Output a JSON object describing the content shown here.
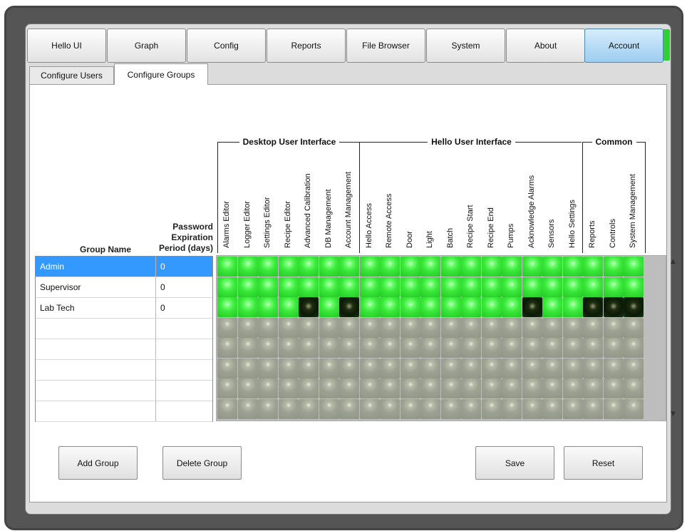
{
  "top_tabs": [
    {
      "label": "Hello UI",
      "active": false
    },
    {
      "label": "Graph",
      "active": false
    },
    {
      "label": "Config",
      "active": false
    },
    {
      "label": "Reports",
      "active": false
    },
    {
      "label": "File Browser",
      "active": false
    },
    {
      "label": "System",
      "active": false
    },
    {
      "label": "About",
      "active": false
    },
    {
      "label": "Account",
      "active": true
    }
  ],
  "sub_tabs": [
    {
      "label": "Configure Users",
      "active": false
    },
    {
      "label": "Configure Groups",
      "active": true
    }
  ],
  "column_groups": [
    {
      "label": "Desktop User Interface"
    },
    {
      "label": "Hello User Interface"
    },
    {
      "label": "Common"
    }
  ],
  "permissions": [
    "Alarms Editor",
    "Logger Editor",
    "Settings Editor",
    "Recipe Editor",
    "Advanced Calibration",
    "DB Management",
    "Account Management",
    "Hello Access",
    "Remote Access",
    "Door",
    "Light",
    "Batch",
    "Recipe Start",
    "Recipe End",
    "Pumps",
    "Acknowledge Alarms",
    "Sensors",
    "Hello Settings",
    "Reports",
    "Controls",
    "System Management"
  ],
  "table_headers": {
    "group_name": "Group Name",
    "password_expiration": [
      "Password",
      "Expiration",
      "Period (days)"
    ]
  },
  "groups": [
    {
      "name": "Admin",
      "expiration_days": "0",
      "selected": true,
      "perms": [
        1,
        1,
        1,
        1,
        1,
        1,
        1,
        1,
        1,
        1,
        1,
        1,
        1,
        1,
        1,
        1,
        1,
        1,
        1,
        1,
        1
      ]
    },
    {
      "name": "Supervisor",
      "expiration_days": "0",
      "selected": false,
      "perms": [
        1,
        1,
        1,
        1,
        1,
        1,
        1,
        1,
        1,
        1,
        1,
        1,
        1,
        1,
        1,
        1,
        1,
        1,
        1,
        1,
        1
      ]
    },
    {
      "name": "Lab Tech",
      "expiration_days": "0",
      "selected": false,
      "perms": [
        1,
        1,
        1,
        1,
        0,
        1,
        0,
        1,
        1,
        1,
        1,
        1,
        1,
        1,
        1,
        0,
        1,
        1,
        0,
        0,
        0
      ]
    }
  ],
  "empty_rows": 5,
  "buttons": {
    "add_group": "Add Group",
    "delete_group": "Delete Group",
    "save": "Save",
    "reset": "Reset"
  },
  "colors": {
    "active_tab": "#9dcdf0",
    "selection": "#3399ff",
    "permission_on": "#3be83b",
    "permission_off": "#0a1a06",
    "permission_empty": "#9da193",
    "status_strip": "#2fd02f"
  }
}
